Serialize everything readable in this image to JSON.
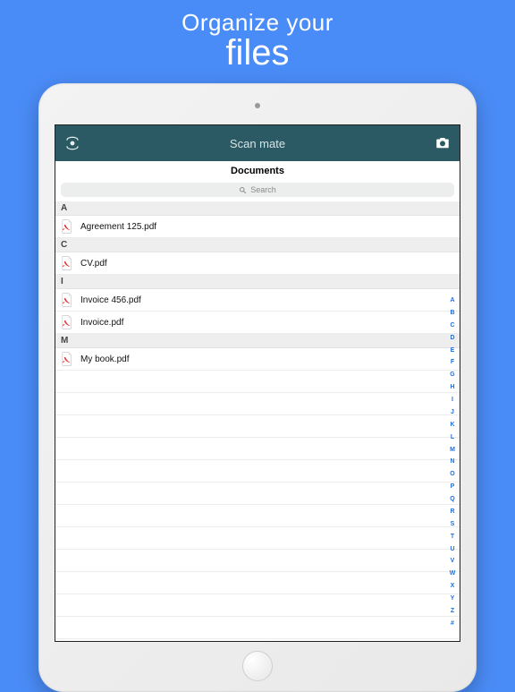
{
  "promo": {
    "line1": "Organize your",
    "line2": "files"
  },
  "navbar": {
    "title": "Scan mate"
  },
  "subheader": "Documents",
  "search": {
    "placeholder": "Search",
    "icon": "magnify"
  },
  "sections": [
    {
      "letter": "A",
      "items": [
        {
          "name": "Agreement 125.pdf"
        }
      ]
    },
    {
      "letter": "C",
      "items": [
        {
          "name": "CV.pdf"
        }
      ]
    },
    {
      "letter": "I",
      "items": [
        {
          "name": "Invoice 456.pdf"
        },
        {
          "name": "Invoice.pdf"
        }
      ]
    },
    {
      "letter": "M",
      "items": [
        {
          "name": "My book.pdf"
        }
      ]
    }
  ],
  "index_letters": [
    "A",
    "B",
    "C",
    "D",
    "E",
    "F",
    "G",
    "H",
    "I",
    "J",
    "K",
    "L",
    "M",
    "N",
    "O",
    "P",
    "Q",
    "R",
    "S",
    "T",
    "U",
    "V",
    "W",
    "X",
    "Y",
    "Z",
    "#"
  ],
  "colors": {
    "accent": "#2b5a64",
    "bg": "#4a8cf7",
    "index": "#1f6fe0"
  }
}
